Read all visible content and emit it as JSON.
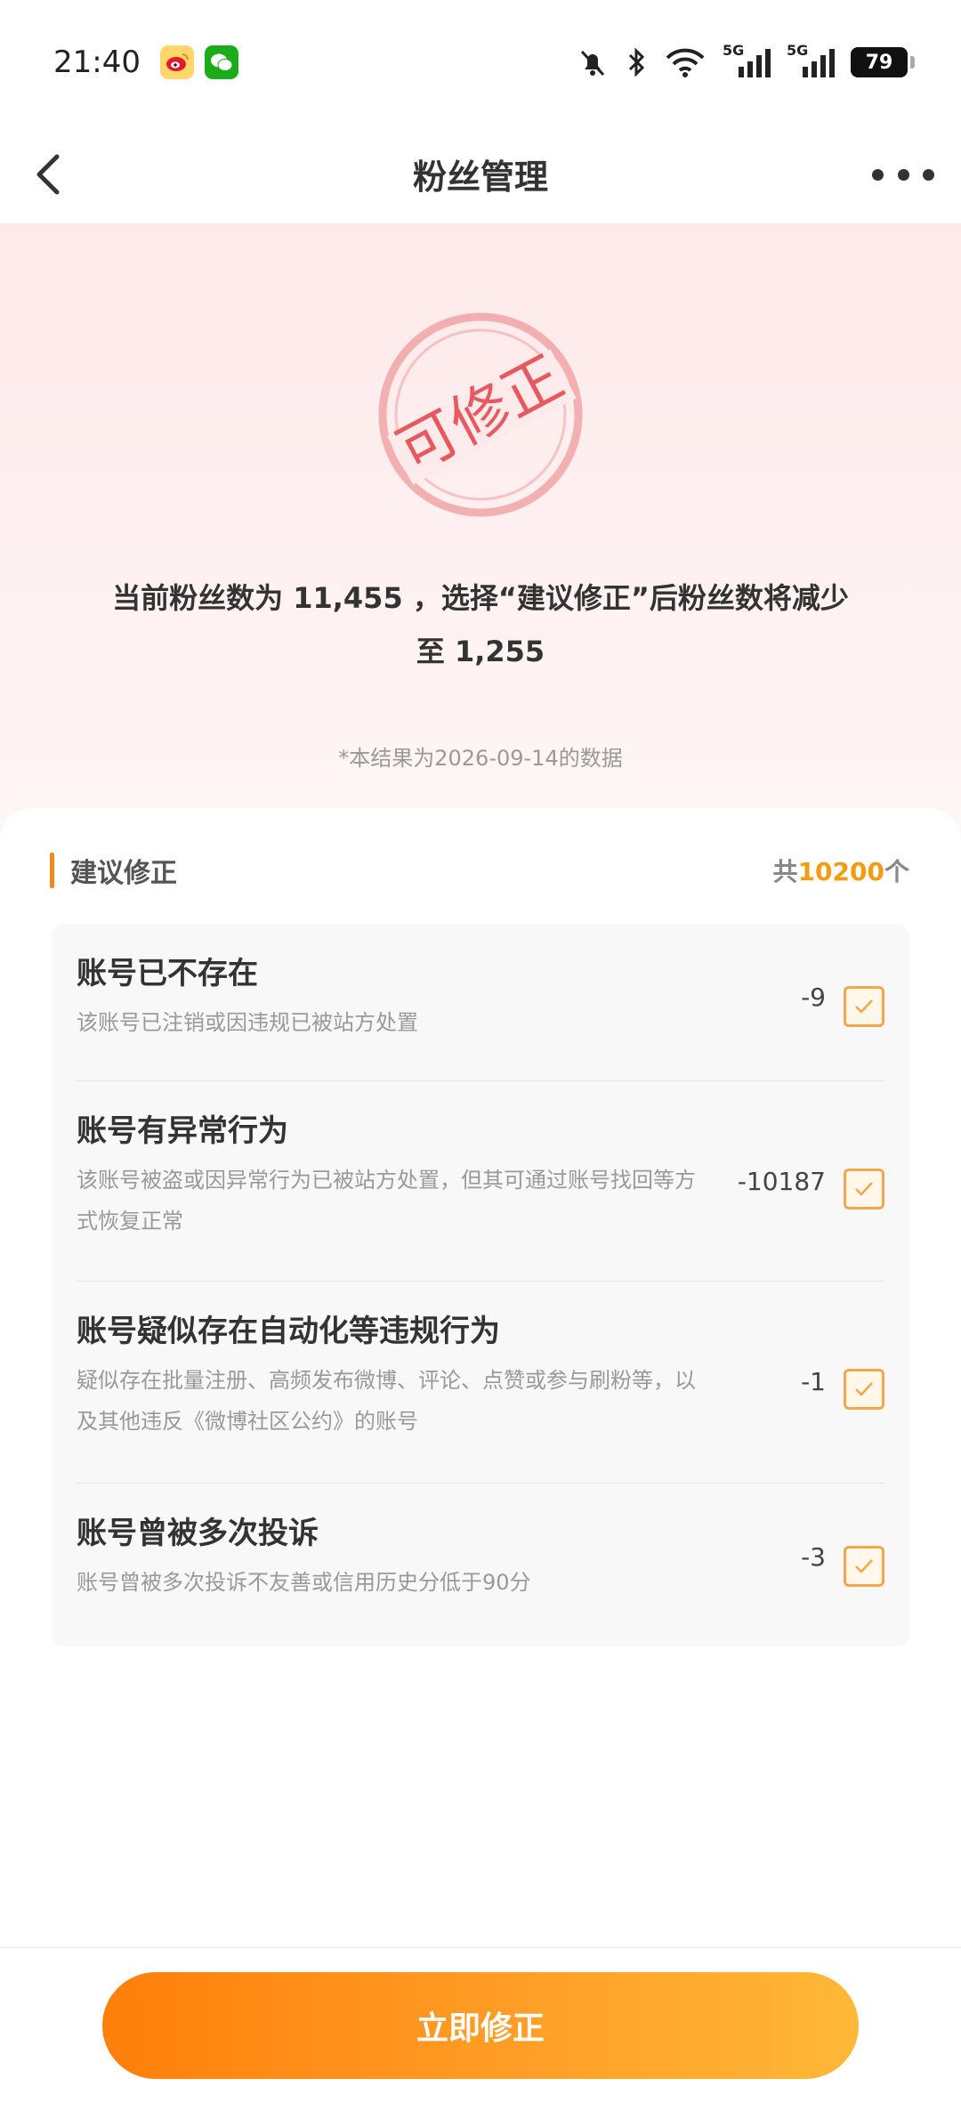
{
  "status_bar": {
    "time": "21:40",
    "battery": "79",
    "network_1": "5G",
    "network_2": "5G"
  },
  "nav": {
    "title": "粉丝管理"
  },
  "hero": {
    "stamp_text": "可修正",
    "summary_line1": "当前粉丝数为 11,455 ，选择“建议修正”后粉丝数将减少",
    "summary_line2": "至 1,255",
    "note": "*本结果为2026-09-14的数据"
  },
  "section": {
    "title": "建议修正",
    "total_prefix": "共",
    "total_num": "10200",
    "total_suffix": "个"
  },
  "items": [
    {
      "title": "账号已不存在",
      "desc": "该账号已注销或因违规已被站方处置",
      "count": "-9",
      "checked": true
    },
    {
      "title": "账号有异常行为",
      "desc": "该账号被盗或因异常行为已被站方处置，但其可通过账号找回等方式恢复正常",
      "count": "-10187",
      "checked": true
    },
    {
      "title": "账号疑似存在自动化等违规行为",
      "desc": "疑似存在批量注册、高频发布微博、评论、点赞或参与刷粉等，以及其他违反《微博社区公约》的账号",
      "count": "-1",
      "checked": true
    },
    {
      "title": "账号曾被多次投诉",
      "desc": "账号曾被多次投诉不友善或信用历史分低于90分",
      "count": "-3",
      "checked": true
    }
  ],
  "cta_label": "立即修正",
  "colors": {
    "accent": "#f39c12",
    "stamp": "#e8595f",
    "cta_start": "#ff7f0a",
    "cta_end": "#ffb837"
  }
}
